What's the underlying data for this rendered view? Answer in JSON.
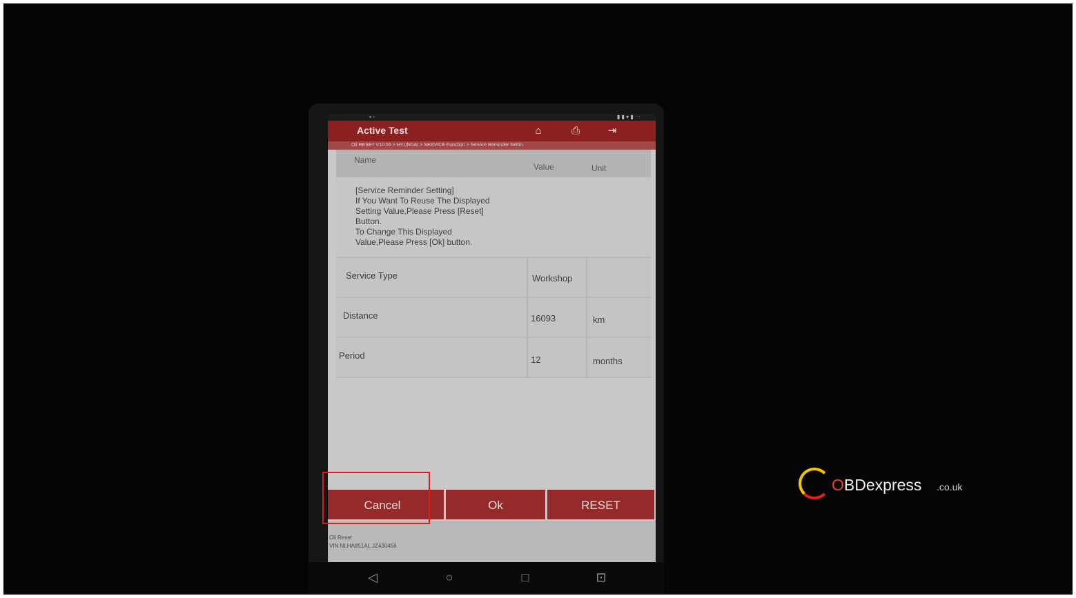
{
  "app": {
    "title": "Active Test",
    "status_left": "▪ ▫",
    "status_right": "▮ ▮ ▾ ▮ ···"
  },
  "toolbar": {
    "home_icon": "home-icon",
    "print_icon": "printer-icon",
    "exit_icon": "exit-icon"
  },
  "breadcrumb": "Oil RESET V10.55 > HYUNDAI > SERVICE Function > Service Reminder Settin",
  "table": {
    "headers": {
      "name": "Name",
      "value": "Value",
      "unit": "Unit"
    },
    "info_lines": [
      "[Service Reminder Setting]",
      "If You Want To Reuse The Displayed",
      "Setting Value,Please Press [Reset]",
      "Button.",
      "To Change This Displayed",
      "Value,Please Press [Ok] button."
    ],
    "rows": [
      {
        "name": "Service Type",
        "value": "Workshop",
        "unit": ""
      },
      {
        "name": "Distance",
        "value": "16093",
        "unit": "km"
      },
      {
        "name": "Period",
        "value": "12",
        "unit": "months"
      }
    ]
  },
  "buttons": {
    "cancel": "Cancel",
    "ok": "Ok",
    "reset": "RESET"
  },
  "footer": {
    "line1": "Oil Reset",
    "line2": "VIN NLHA851AL JZ430458"
  },
  "nav": {
    "back": "◁",
    "home": "○",
    "recents": "□",
    "screenshot": "⊡"
  },
  "watermark": {
    "brand_o": "O",
    "brand_rest": "BDexpress",
    "suffix": ".co.uk"
  },
  "colors": {
    "accent": "#8b2020",
    "button": "#962a2a",
    "highlight": "#e21a1a"
  }
}
